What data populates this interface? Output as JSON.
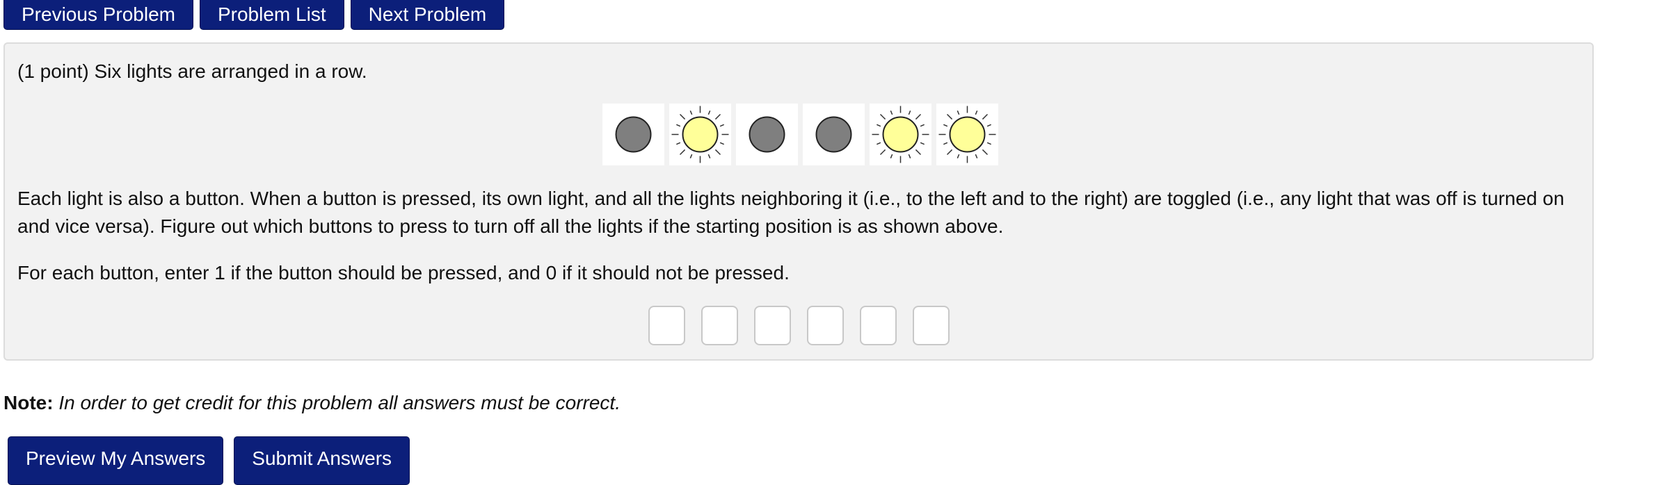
{
  "nav": {
    "previous": "Previous Problem",
    "list": "Problem List",
    "next": "Next Problem"
  },
  "problem": {
    "intro": "(1 point) Six lights are arranged in a row.",
    "lights": [
      "off",
      "on",
      "off",
      "off",
      "on",
      "on"
    ],
    "instructions": "Each light is also a button. When a button is pressed, its own light, and all the lights neighboring it (i.e., to the left and to the right) are toggled (i.e., any light that was off is turned on and vice versa). Figure out which buttons to press to turn off all the lights if the starting position is as shown above.",
    "answer_instructions": "For each button, enter 1 if the button should be pressed, and 0 if it should not be pressed.",
    "answers": [
      "",
      "",
      "",
      "",
      "",
      ""
    ]
  },
  "note": {
    "label": "Note:",
    "text": "In order to get credit for this problem all answers must be correct."
  },
  "actions": {
    "preview": "Preview My Answers",
    "submit": "Submit Answers"
  },
  "colors": {
    "button_bg": "#0c1f7a",
    "panel_bg": "#f2f2f2",
    "light_on": "#ffff99",
    "light_off": "#7f7f7f"
  }
}
